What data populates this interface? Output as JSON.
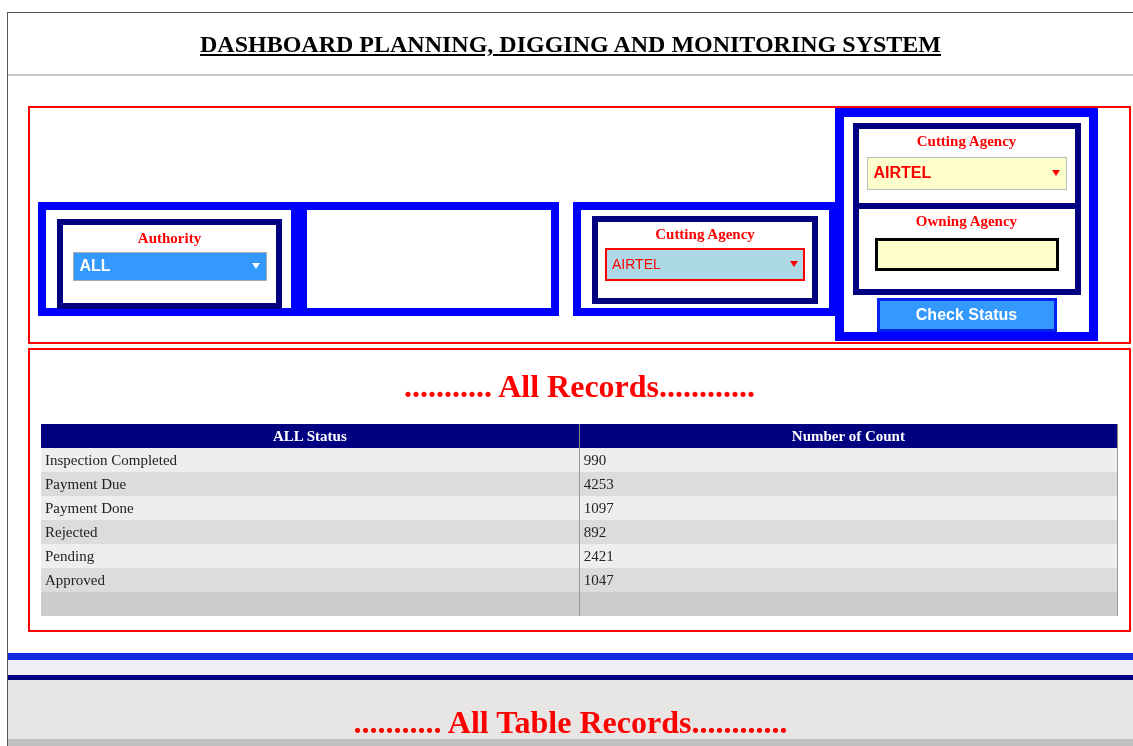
{
  "header": {
    "title": "DASHBOARD PLANNING, DIGGING AND MONITORING SYSTEM"
  },
  "filters": {
    "authority": {
      "label": "Authority",
      "value": "ALL"
    },
    "cutting_agency": {
      "label": "Cutting Agency",
      "value": "AIRTEL"
    },
    "side_panel": {
      "cutting_agency": {
        "label": "Cutting Agency",
        "value": "AIRTEL"
      },
      "owning_agency": {
        "label": "Owning Agency"
      },
      "button": "Check Status"
    }
  },
  "records": {
    "title": "........... All Records............",
    "columns": [
      "ALL Status",
      "Number of Count"
    ],
    "rows": [
      [
        "Inspection Completed",
        "990"
      ],
      [
        "Payment Due",
        "4253"
      ],
      [
        "Payment Done",
        "1097"
      ],
      [
        "Rejected",
        "892"
      ],
      [
        "Pending",
        "2421"
      ],
      [
        "Approved",
        "1047"
      ]
    ]
  },
  "table_records": {
    "title": "........... All Table Records............"
  }
}
